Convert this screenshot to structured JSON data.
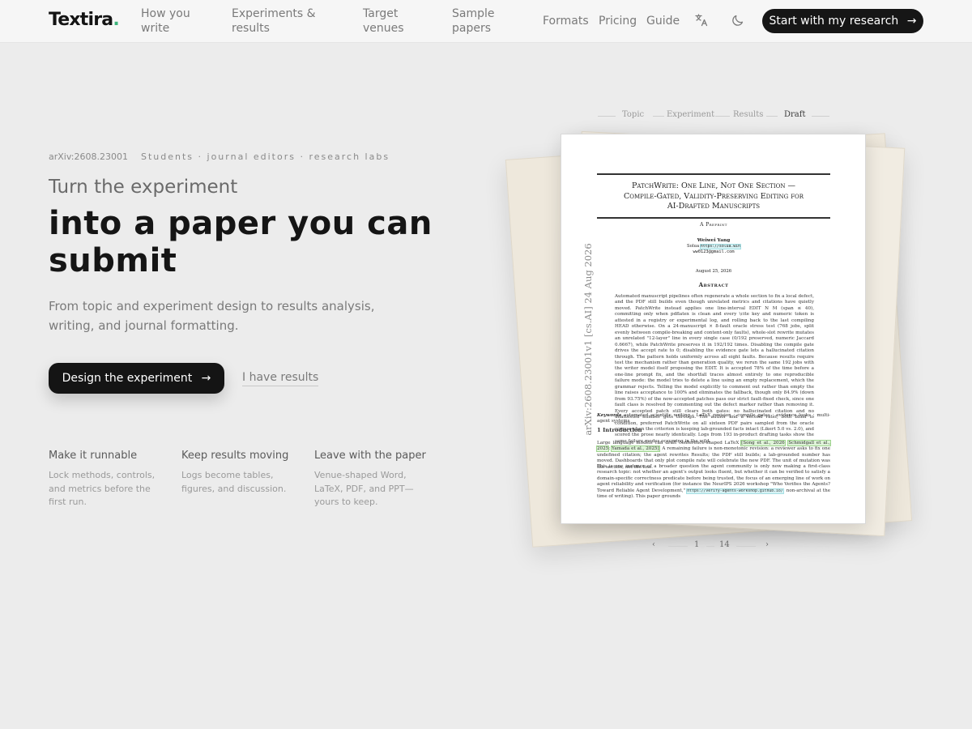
{
  "brand": {
    "name": "Textira",
    "dot": "."
  },
  "nav": {
    "links": [
      {
        "line1": "How you",
        "line2": "write"
      },
      {
        "line1": "Experiments &",
        "line2": "results"
      },
      {
        "line1": "Target",
        "line2": "venues"
      },
      {
        "line1": "Sample",
        "line2": "papers"
      }
    ],
    "formats": "Formats",
    "pricing": "Pricing",
    "guide": "Guide",
    "cta": "Start with my research",
    "arrow": "→"
  },
  "hero": {
    "arxiv_id": "arXiv:2608.23001",
    "audience": "Students · journal editors · research labs",
    "kicker": "Turn the experiment",
    "headline_line1": "into a paper you can",
    "headline_line2": "submit",
    "lede": "From topic and experiment design to results analysis, writing, and journal formatting.",
    "primary_cta": "Design the experiment",
    "primary_arrow": "→",
    "secondary_cta": "I have results"
  },
  "features": [
    {
      "title": "Make it runnable",
      "desc": "Lock methods, controls, and metrics before the first run."
    },
    {
      "title": "Keep results moving",
      "desc": "Logs become tables, figures, and discussion."
    },
    {
      "title": "Leave with the paper",
      "desc": "Venue-shaped Word, LaTeX, PDF, and PPT—yours to keep."
    }
  ],
  "steps": [
    "Topic",
    "Experiment",
    "Results",
    "Draft"
  ],
  "paper": {
    "arxiv_stamp": "arXiv:2608.23001v1  [cs.AI]  24 Aug 2026",
    "title_l1": "PatchWrite: One Line, Not One Section —",
    "title_l2": "Compile-Gated, Validity-Preserving Editing for",
    "title_l3": "AI-Drafted Manuscripts",
    "preprint": "A Preprint",
    "author": "Weiwei Yang",
    "affil_prefix": "Solua",
    "affil_url": "https://solua.win",
    "email": "ww0123@gmail.com",
    "date": "August 25, 2026",
    "abstract_heading": "Abstract",
    "abstract": "Automated manuscript pipelines often regenerate a whole section to fix a local defect, and the PDF still builds even though unrelated metrics and citations have quietly moved. PatchWrite instead applies one line-interval EDIT N M (span ≤ 40), committing only when pdflatex is clean and every \\cite key and numeric token is attested in a registry or experimental log, and rolling back to the last compiling HEAD otherwise. On a 24-manuscript × 8-fault oracle stress test (768 jobs, split evenly between compile-breaking and content-only faults), whole-slot rewrite mutates an unrelated \"12-layer\" line in every single case (0/192 preserved, numeric Jaccard 0.6667), while PatchWrite preserves it in 192/192 times. Disabling the compile gate drives the accept rate to 0; disabling the evidence gate lets a hallucinated citation through. The pattern holds uniformly across all eight faults. Because results require test the mechanism rather than generation quality, we rerun the same 192 jobs with the writer model itself proposing the EDIT. It is accepted 78% of the time before a one-line prompt fix, and the shortfall traces almost entirely to one reproducible failure mode: the model tries to delete a line using an empty replacement, which the grammar rejects. Telling the model explicitly to comment out rather than empty the line raises acceptance to 100% and eliminates the fallback, though only 84.9% (down from 93.75%) of the now-accepted patches pass our strict fault-fixed check, since one fault class is resolved by commenting out the defect marker rather than removing it. Every accepted patch still clears both gates: no hallucinated citation and no unattested number gets through. The author and a second rater, both blind to condition, preferred PatchWrite on all sixteen PDF pairs sampled from the oracle corpus when the criterion is keeping lab-grounded facts intact (Likert 5.0 vs. 2.0), and scored the prose nearly identically. Logs from 193 in-product drafting tasks show the same failure modes occurring in the wild.",
    "keywords_label": "Keywords",
    "keywords": "automated scientific writing · LaTeX revision · compile gates · evidence locks · multi-agent systems",
    "intro_heading": "1   Introduction",
    "intro_p1_a": "Large language models can draft conference-shaped LaTeX",
    "cite1": "[Song et al., 2026",
    "cite2": "Schmidgall et al., 2025",
    "cite3": "Yamada et al., 2025]",
    "intro_p1_b": ". A remaining failure is non-monotonic revision: a reviewer asks to fix one undefined citation; the agent rewrites Results; the PDF still builds; a lab-grounded number has moved. Dashboards that only plot compile rate will celebrate the new PDF. The unit of mutation was the section, not the line.",
    "intro_p2_a": "This is one instance of a broader question the agent community is only now making a first-class research topic: not whether an agent's output looks fluent, but whether it can be verified to satisfy a domain-specific correctness predicate before being trusted, the focus of an emerging line of work on agent reliability and verification (for instance the NeurIPS 2026 workshop \"Who Verifies the Agents? Toward Reliable Agent Development,\"",
    "intro_url": "https://verify-agents-workshop.github.io/",
    "intro_p2_b": "; non-archival at the time of writing). This paper grounds"
  },
  "pager": {
    "prev": "‹",
    "page": "1",
    "total": "14",
    "next": "›"
  }
}
